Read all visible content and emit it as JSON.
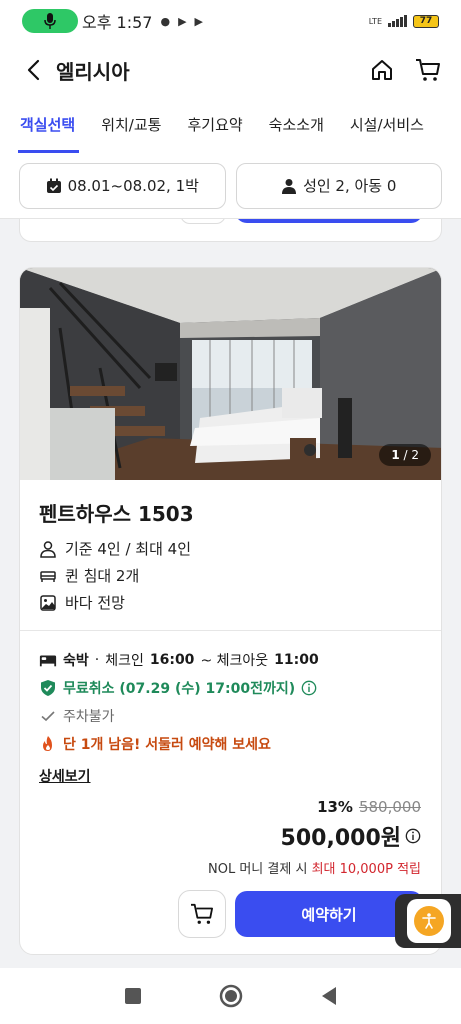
{
  "status_bar": {
    "time": "오후 1:57",
    "network": "LTE",
    "battery": "77"
  },
  "header": {
    "title": "엘리시아"
  },
  "tabs": [
    {
      "label": "객실선택",
      "active": true
    },
    {
      "label": "위치/교통",
      "active": false
    },
    {
      "label": "후기요약",
      "active": false
    },
    {
      "label": "숙소소개",
      "active": false
    },
    {
      "label": "시설/서비스",
      "active": false
    }
  ],
  "filters": {
    "dates": "08.01~08.02, 1박",
    "guests": "성인 2, 아동 0"
  },
  "room": {
    "photo_index": "1",
    "photo_total": "2",
    "name": "펜트하우스 1503",
    "capacity": "기준 4인 / 최대 4인",
    "bed": "퀸 침대 2개",
    "view": "바다 전망",
    "stay_type": "숙박",
    "checkin_label": "체크인",
    "checkin_time": "16:00",
    "checkout_label": "~ 체크아웃",
    "checkout_time": "11:00",
    "free_cancel": "무료취소 (07.29 (수) 17:00전까지)",
    "parking": "주차불가",
    "urgency": "단 1개 남음! 서둘러 예약해 보세요",
    "detail_link": "상세보기",
    "discount_rate": "13%",
    "original_price": "580,000",
    "final_price": "500,000원",
    "points_prefix": "NOL 머니 결제 시",
    "points_accent": "최대 10,000P 적립",
    "book_label": "예약하기"
  },
  "colors": {
    "accent": "#3a4df0",
    "free_cancel": "#1f8a5a",
    "urgent": "#c74a10",
    "points": "#d2262e"
  }
}
